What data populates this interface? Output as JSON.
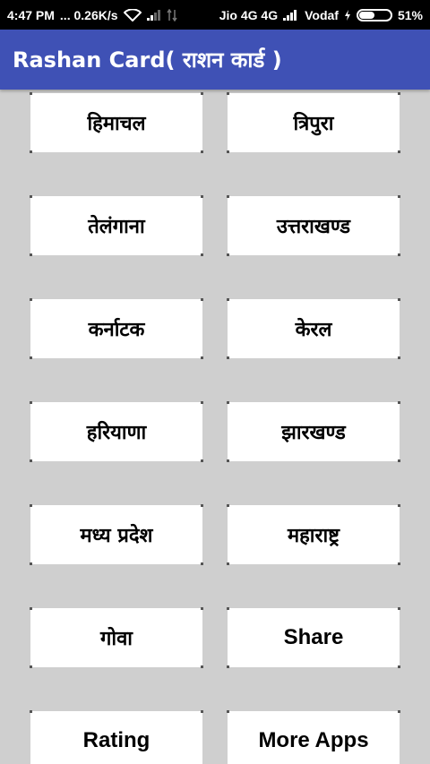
{
  "status_bar": {
    "time": "4:47 PM",
    "speed": "... 0.26K/s",
    "carrier1": "Jio 4G 4G",
    "carrier2": "Vodaf",
    "battery_text": "51%",
    "battery_level": 0.51
  },
  "app_bar": {
    "title": "Rashan Card( राशन कार्ड )"
  },
  "tiles": [
    {
      "label": "हिमाचल"
    },
    {
      "label": "त्रिपुरा"
    },
    {
      "label": "तेलंगाना"
    },
    {
      "label": "उत्तराखण्ड"
    },
    {
      "label": "कर्नाटक"
    },
    {
      "label": "केरल"
    },
    {
      "label": "हरियाणा"
    },
    {
      "label": "झारखण्ड"
    },
    {
      "label": "मध्य प्रदेश"
    },
    {
      "label": "महाराष्ट्र"
    },
    {
      "label": "गोवा"
    },
    {
      "label": "Share"
    },
    {
      "label": "Rating"
    },
    {
      "label": "More Apps"
    }
  ]
}
